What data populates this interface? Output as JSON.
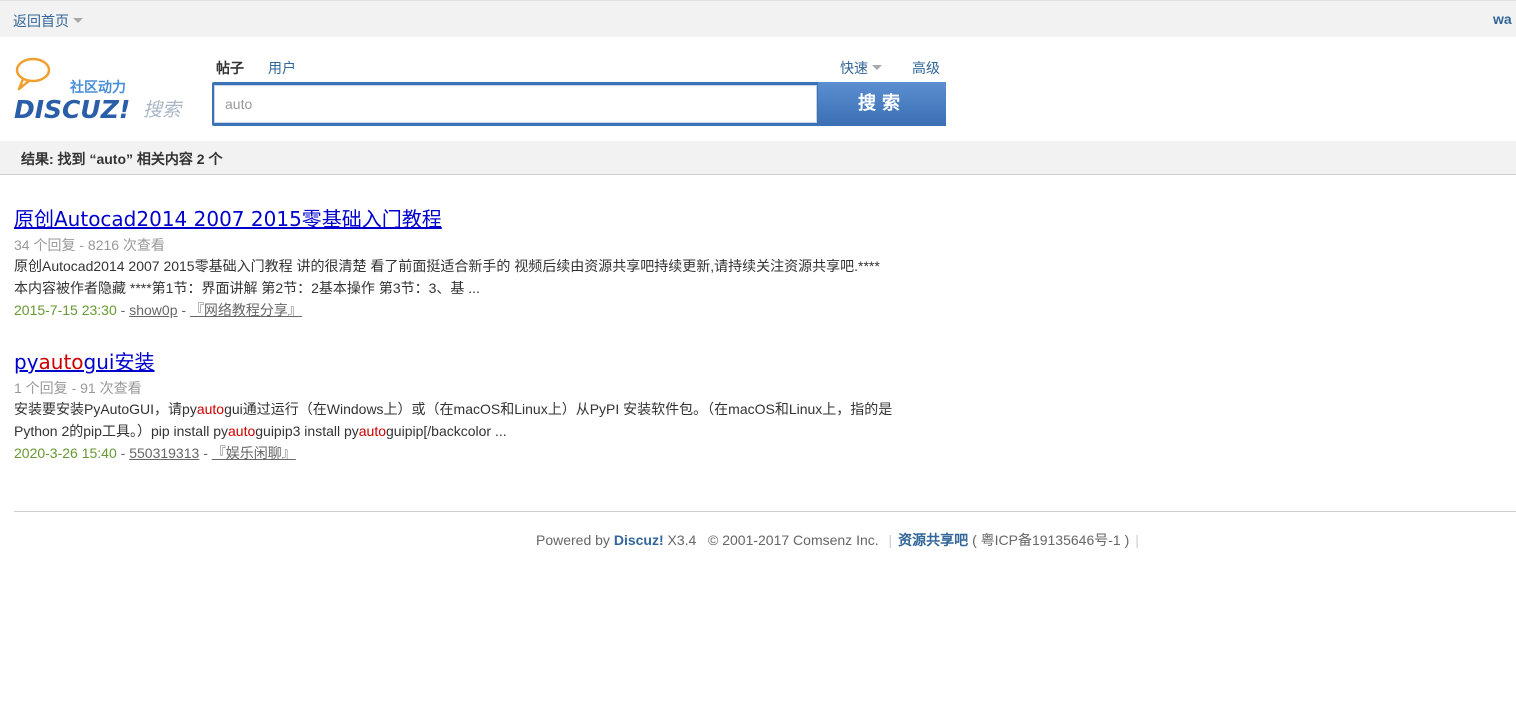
{
  "topbar": {
    "home_label": "返回首页",
    "user_label": "wa"
  },
  "logo": {
    "tagline": "社区动力",
    "brand": "DISCUZ!",
    "suffix": "搜索",
    "accent": "#f0a030",
    "brand_color": "#2a5ea8"
  },
  "search": {
    "tabs": [
      {
        "label": "帖子",
        "active": true
      },
      {
        "label": "用户",
        "active": false
      }
    ],
    "quick_label": "快速",
    "advanced_label": "高级",
    "query": "auto",
    "button_label": "搜索"
  },
  "summary": {
    "text": "结果: 找到 “auto” 相关内容 2 个"
  },
  "results": [
    {
      "title_parts": [
        "原创Autocad2014 2007 2015零基础入门教程"
      ],
      "meta": "34 个回复 - 8216 次查看",
      "desc_line1": "原创Autocad2014 2007 2015零基础入门教程 讲的很清楚 看了前面挺适合新手的 视频后续由资源共享吧持续更新,请持续关注资源共享吧.****",
      "desc_line2": "本内容被作者隐藏 ****第1节：界面讲解 第2节：2基本操作 第3节：3、基 ...",
      "date": "2015-7-15 23:30",
      "author": "show0p",
      "forum": "『网络教程分享』"
    },
    {
      "title_pre": "py",
      "title_hl": "auto",
      "title_post": "gui安装",
      "meta": "1 个回复 - 91 次查看",
      "desc1_a": "安装要安装PyAutoGUI，请py",
      "desc1_hl": "auto",
      "desc1_b": "gui通过运行（在Windows上）或（在macOS和Linux上）从PyPI 安装软件包。（在macOS和Linux上，指的是",
      "desc2_a": "Python 2的pip工具。）pip install py",
      "desc2_hl1": "auto",
      "desc2_b": "guipip3 install py",
      "desc2_hl2": "auto",
      "desc2_c": "guipip[/backcolor ...",
      "date": "2020-3-26 15:40",
      "author": "550319313",
      "forum": "『娱乐闲聊』"
    }
  ],
  "footer": {
    "powered": "Powered by",
    "brand": "Discuz!",
    "version": "X3.4",
    "copyright": "© 2001-2017 Comsenz Inc.",
    "site": "资源共享吧",
    "icp": "( 粤ICP备19135646号-1 )"
  }
}
